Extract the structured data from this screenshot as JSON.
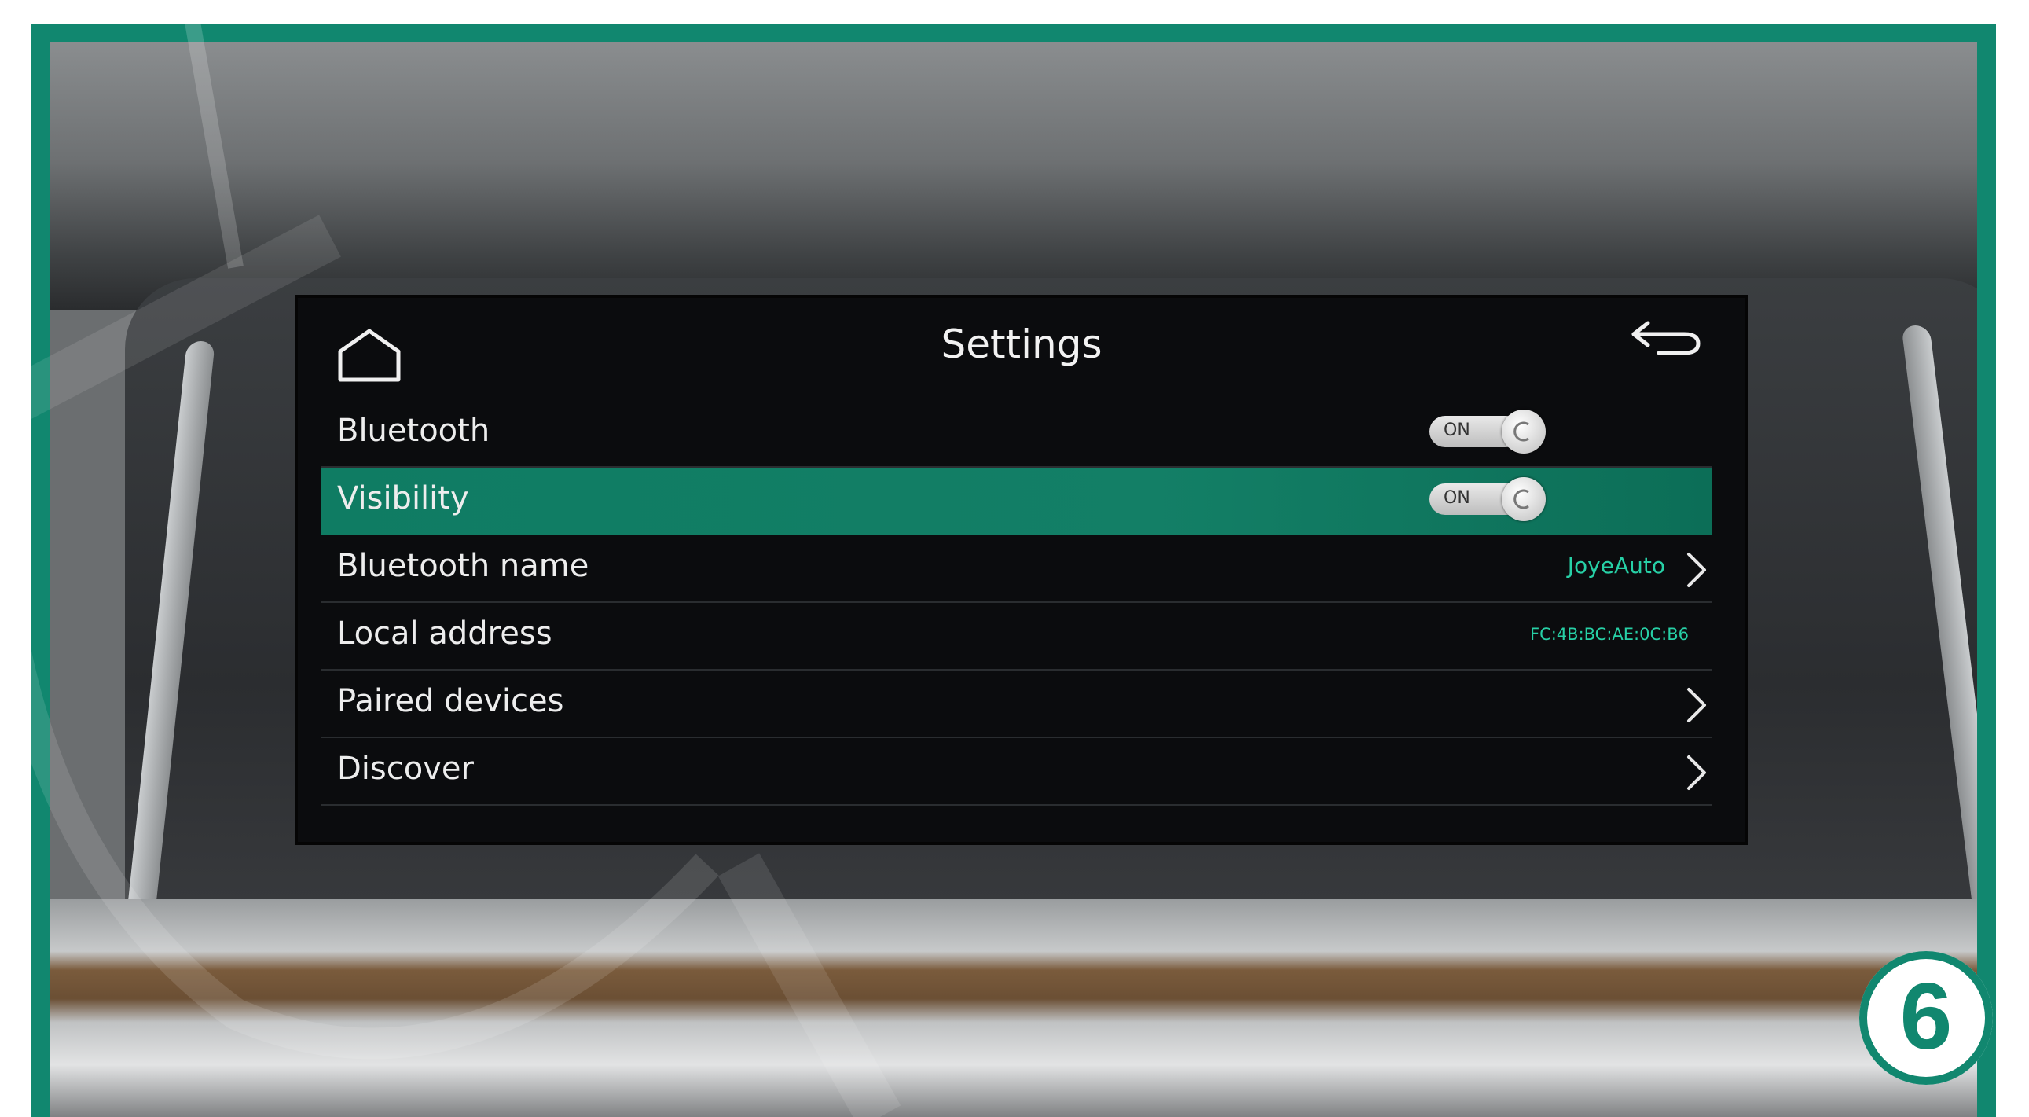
{
  "screen": {
    "title": "Settings",
    "home_icon": "home-icon",
    "back_icon": "back-arrow-icon",
    "rows": [
      {
        "label": "Bluetooth",
        "toggle": "ON",
        "selected": false
      },
      {
        "label": "Visibility",
        "toggle": "ON",
        "selected": true
      },
      {
        "label": "Bluetooth name",
        "value": "JoyeAuto",
        "chevron": true
      },
      {
        "label": "Local address",
        "value": "FC:4B:BC:AE:0C:B6"
      },
      {
        "label": "Paired devices",
        "chevron": true
      },
      {
        "label": "Discover",
        "chevron": true
      }
    ]
  },
  "step_badge": "6",
  "colors": {
    "accent": "#11876f",
    "selection": "#137f66",
    "value_text": "#27d0a6"
  }
}
